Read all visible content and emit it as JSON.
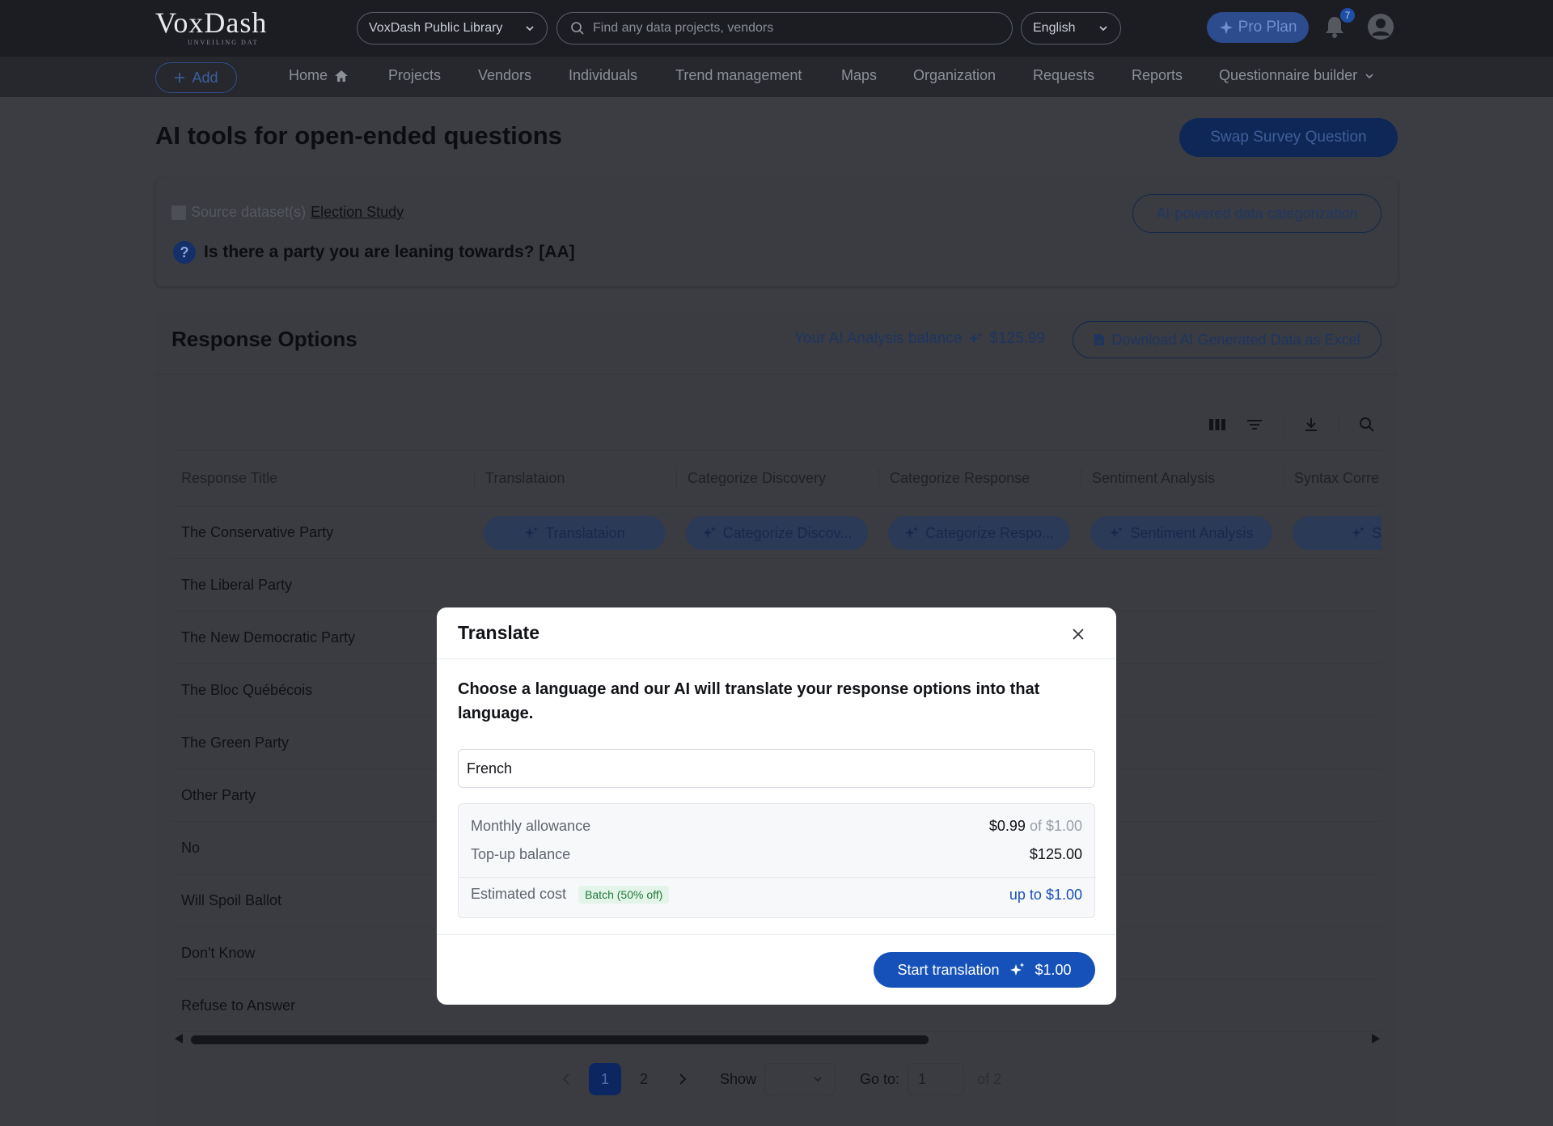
{
  "header": {
    "logo": "VoxDash",
    "logo_sub": "UNVEILING DAT",
    "library_select": "VoxDash Public Library",
    "search_placeholder": "Find any data projects, vendors",
    "language_select": "English",
    "pro_plan": "Pro Plan",
    "notification_count": "7"
  },
  "nav": {
    "add_label": "Add",
    "items": [
      "Home",
      "Projects",
      "Vendors",
      "Individuals",
      "Trend management",
      "Maps",
      "Organization",
      "Requests",
      "Reports",
      "Questionnaire builder"
    ]
  },
  "page": {
    "title": "AI tools for open-ended questions",
    "swap_button": "Swap Survey Question",
    "source_label": "Source dataset(s)",
    "source_link": "Election Study",
    "ai_categorization_button": "AI-powered data categorization",
    "question_icon": "?",
    "question": "Is there a party you are leaning towards? [AA]"
  },
  "responses": {
    "title": "Response Options",
    "balance_label": "Your AI Analysis balance",
    "balance_value": "$125.99",
    "download_button": "Download AI Generated Data as Excel",
    "columns": [
      "Response Title",
      "Translataion",
      "Categorize Discovery",
      "Categorize Response",
      "Sentiment Analysis",
      "Syntax Corre"
    ],
    "ai_buttons": [
      "Translataion",
      "Categorize Discov...",
      "Categorize Respo...",
      "Sentiment Analysis",
      "Syntax"
    ],
    "rows": [
      "The Conservative Party",
      "The Liberal Party",
      "The New Democratic Party",
      "The Bloc Québécois",
      "The Green Party",
      "Other Party",
      "No",
      "Will Spoil Ballot",
      "Don't Know",
      "Refuse to Answer"
    ]
  },
  "pagination": {
    "pages": [
      "1",
      "2"
    ],
    "current_page": "1",
    "show_label": "Show",
    "goto_label": "Go to:",
    "goto_value": "1",
    "of_label": "of 2"
  },
  "modal": {
    "title": "Translate",
    "description": "Choose a language and our AI will translate your response options into that language.",
    "language_value": "French",
    "monthly_label": "Monthly allowance",
    "monthly_value": "$0.99",
    "monthly_total": "of $1.00",
    "topup_label": "Top-up balance",
    "topup_value": "$125.00",
    "estimated_label": "Estimated cost",
    "batch_badge": "Batch (50% off)",
    "estimated_value": "up to $1.00",
    "start_label": "Start translation",
    "start_cost": "$1.00"
  },
  "colors": {
    "primary": "#1551b8",
    "topbar": "#1b1d23",
    "overlay_bg": "#3b3d42",
    "batch_green": "#237a3c"
  }
}
